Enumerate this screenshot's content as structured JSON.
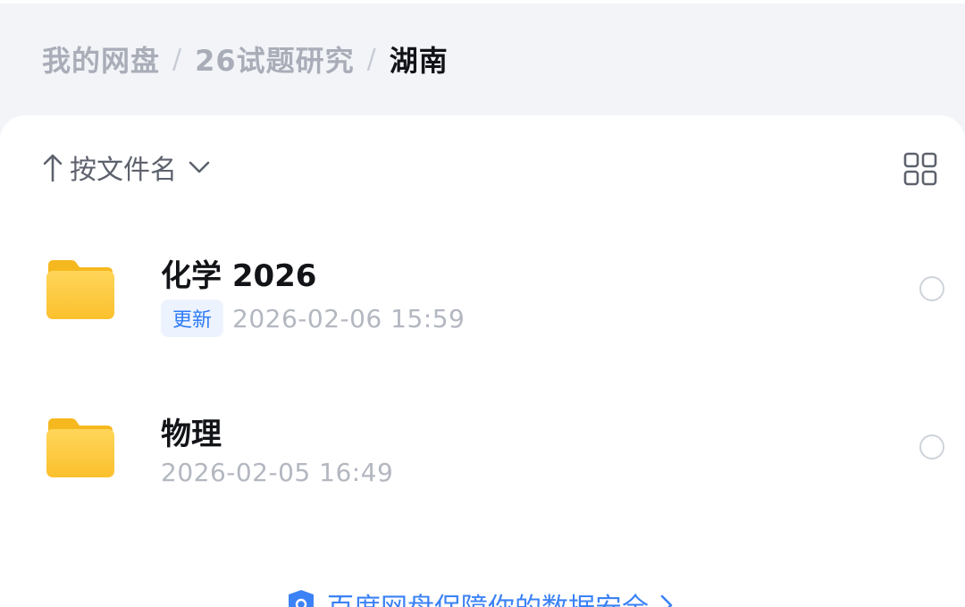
{
  "breadcrumb": {
    "items": [
      "我的网盘",
      "26试题研究"
    ],
    "separator": "/",
    "current": "湖南"
  },
  "sort": {
    "label": "按文件名"
  },
  "files": [
    {
      "name": "化学 2026",
      "badge": "更新",
      "timestamp": "2026-02-06 15:59"
    },
    {
      "name": "物理",
      "badge": "",
      "timestamp": "2026-02-05 16:49"
    }
  ],
  "security": {
    "label": "百度网盘保障你的数据安全"
  },
  "colors": {
    "accent": "#3b82f6",
    "folder": "#fbc531",
    "badge_bg": "#edf3fe"
  }
}
